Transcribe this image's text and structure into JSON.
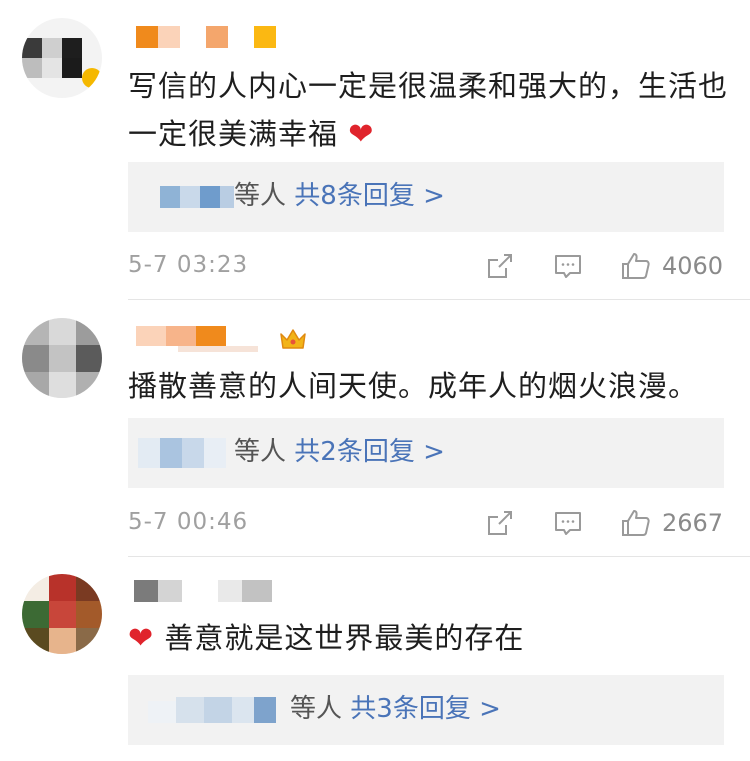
{
  "comments": [
    {
      "text": "写信的人内心一定是很温柔和强大的，生活也一定很美满幸福",
      "emoji_heart": "❤",
      "reply_suffix": "等人",
      "reply_count_text": "共8条回复 >",
      "time": "5-7 03:23",
      "likes": "4060"
    },
    {
      "text": "播散善意的人间天使。成年人的烟火浪漫。",
      "reply_suffix": "等人",
      "reply_count_text": "共2条回复 >",
      "time": "5-7 00:46",
      "likes": "2667"
    },
    {
      "text": "善意就是这世界最美的存在",
      "emoji_heart": "❤",
      "reply_suffix": "等人",
      "reply_count_text": "共3条回复 >"
    }
  ],
  "icons": {
    "share": "share-icon",
    "comment": "comment-icon",
    "like": "thumbs-up-icon",
    "crown": "crown-icon"
  },
  "colors": {
    "link": "#4a74b8",
    "heart": "#e0242c",
    "reply_bg": "#f2f2f2",
    "meta": "#a0a0a0"
  }
}
